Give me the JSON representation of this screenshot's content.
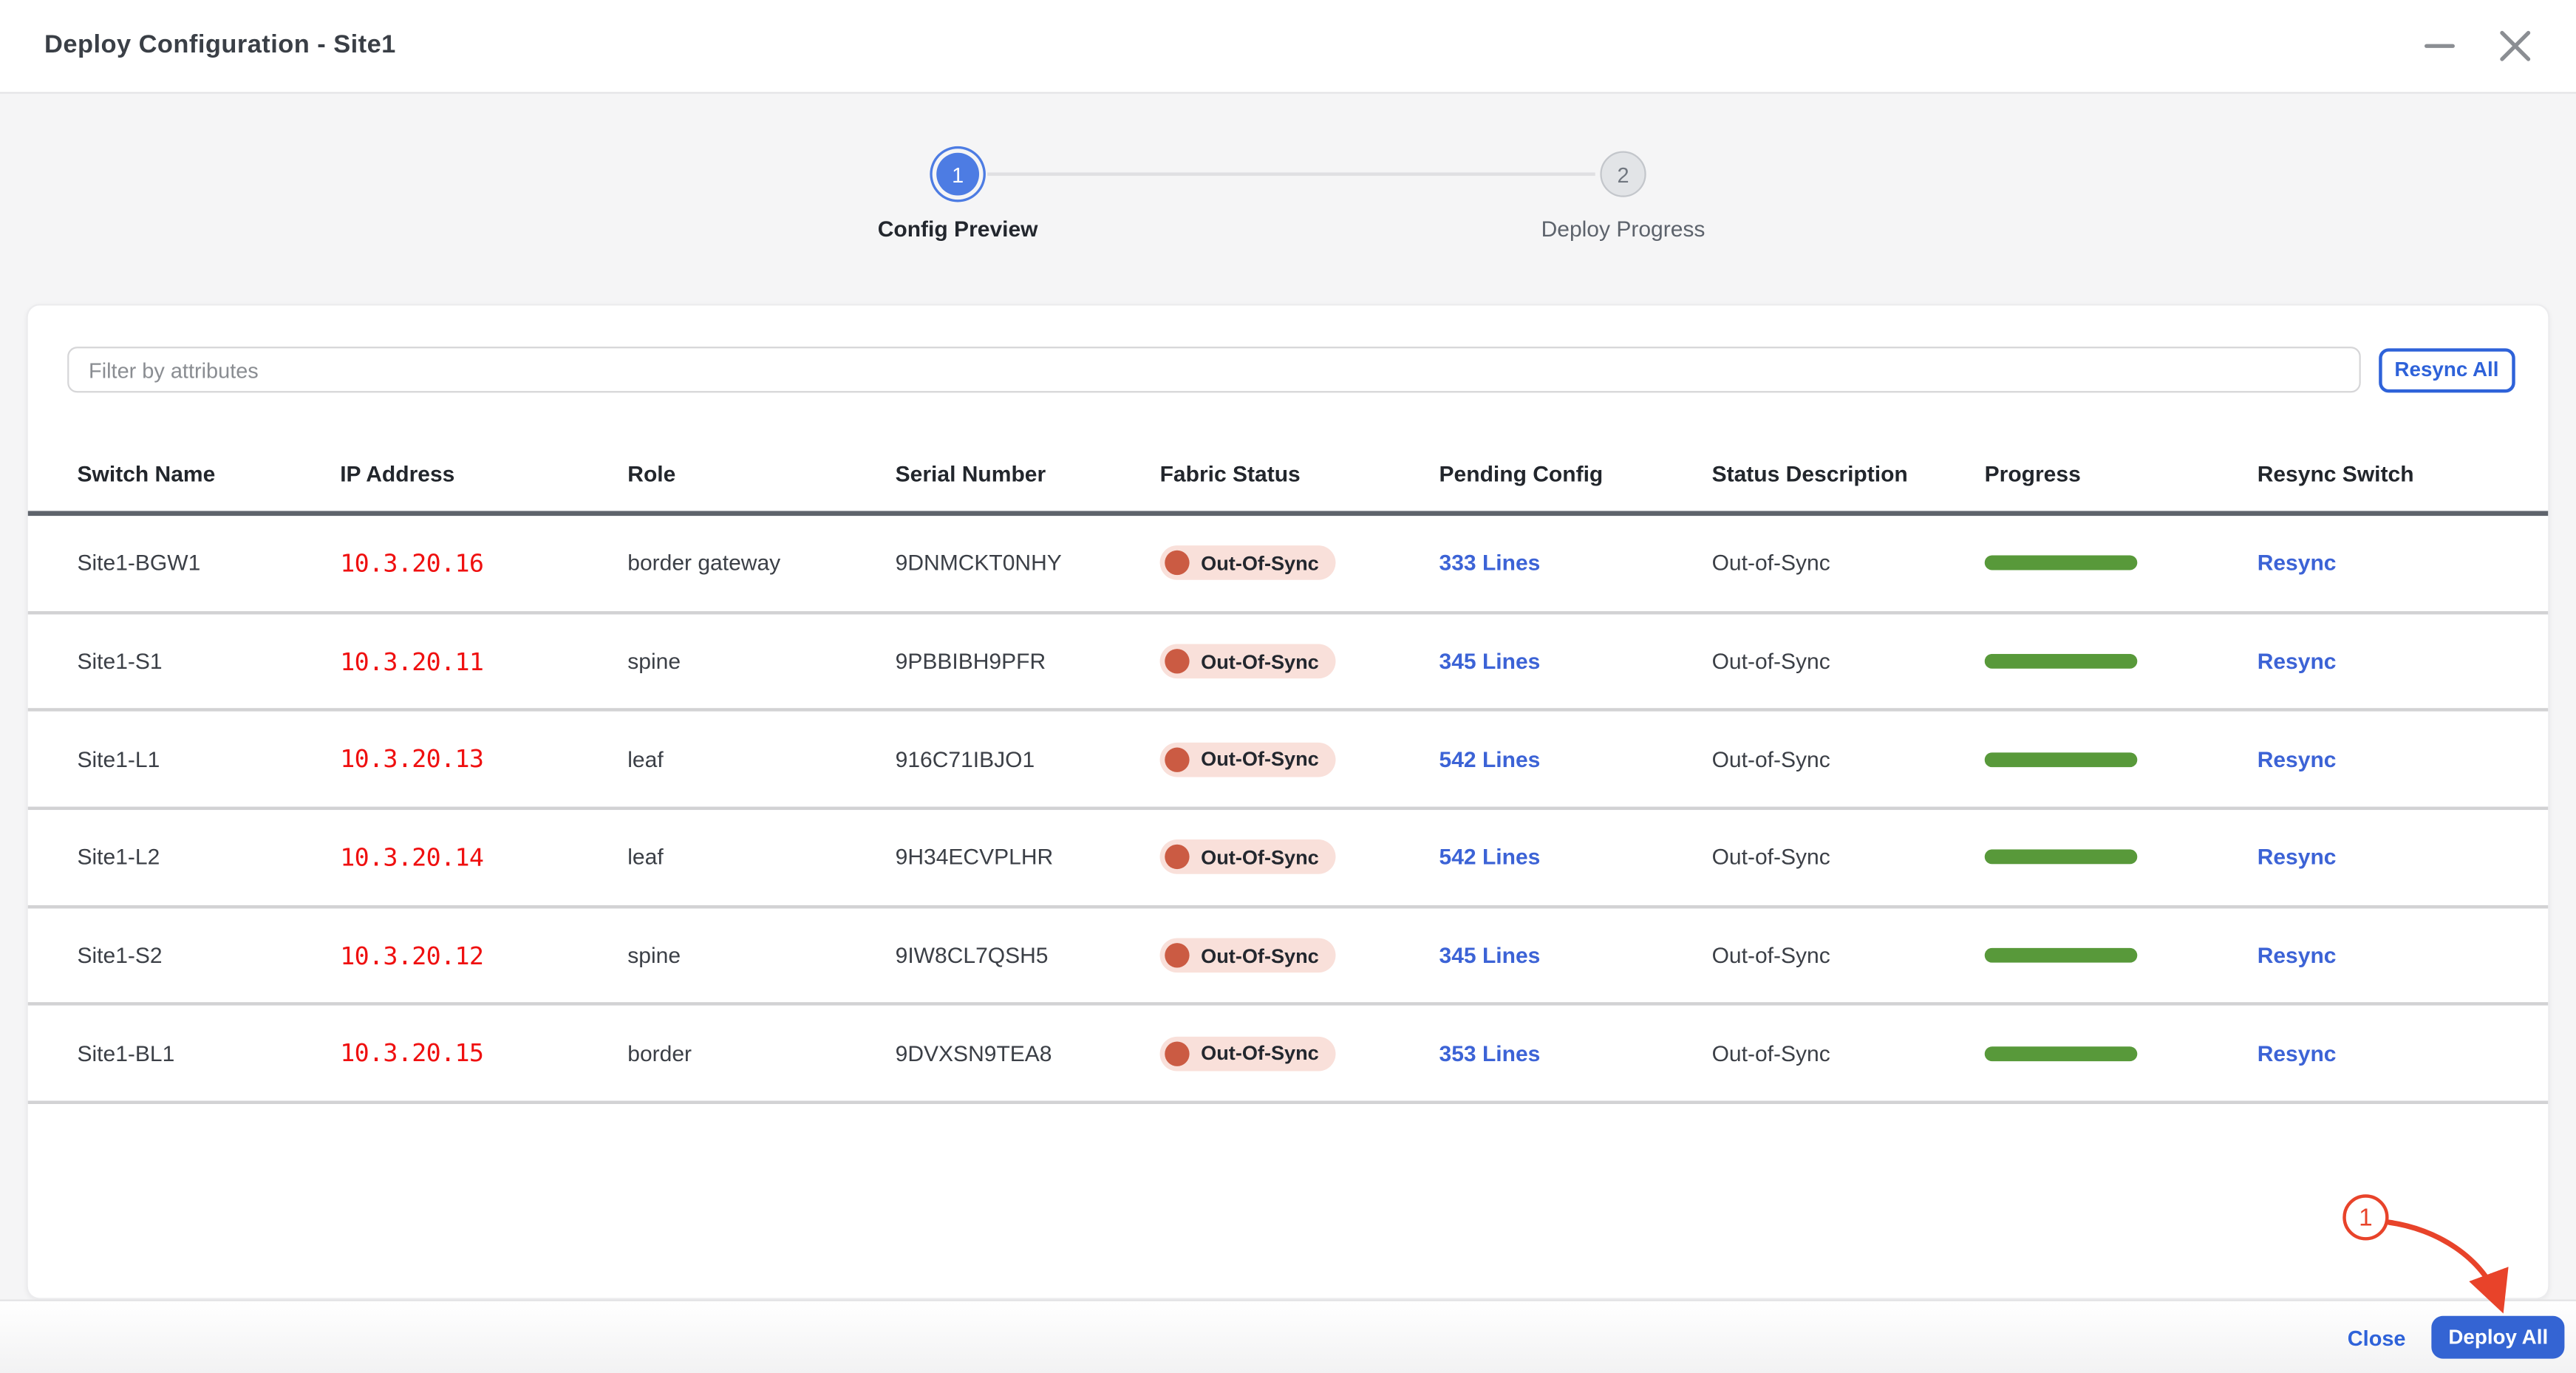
{
  "window": {
    "title": "Deploy Configuration - Site1"
  },
  "stepper": {
    "steps": [
      {
        "number": "1",
        "label": "Config Preview",
        "state": "active"
      },
      {
        "number": "2",
        "label": "Deploy Progress",
        "state": "inactive"
      }
    ]
  },
  "toolbar": {
    "filter_placeholder": "Filter by attributes",
    "resync_all_label": "Resync All"
  },
  "table": {
    "columns": [
      "Switch Name",
      "IP Address",
      "Role",
      "Serial Number",
      "Fabric Status",
      "Pending Config",
      "Status Description",
      "Progress",
      "Resync Switch"
    ],
    "rows": [
      {
        "switch_name": "Site1-BGW1",
        "ip": "10.3.20.16",
        "role": "border gateway",
        "serial": "9DNMCKT0NHY",
        "fabric_status": "Out-Of-Sync",
        "pending_config": "333 Lines",
        "status_description": "Out-of-Sync",
        "progress_percent": 100,
        "resync_label": "Resync"
      },
      {
        "switch_name": "Site1-S1",
        "ip": "10.3.20.11",
        "role": "spine",
        "serial": "9PBBIBH9PFR",
        "fabric_status": "Out-Of-Sync",
        "pending_config": "345 Lines",
        "status_description": "Out-of-Sync",
        "progress_percent": 100,
        "resync_label": "Resync"
      },
      {
        "switch_name": "Site1-L1",
        "ip": "10.3.20.13",
        "role": "leaf",
        "serial": "916C71IBJO1",
        "fabric_status": "Out-Of-Sync",
        "pending_config": "542 Lines",
        "status_description": "Out-of-Sync",
        "progress_percent": 100,
        "resync_label": "Resync"
      },
      {
        "switch_name": "Site1-L2",
        "ip": "10.3.20.14",
        "role": "leaf",
        "serial": "9H34ECVPLHR",
        "fabric_status": "Out-Of-Sync",
        "pending_config": "542 Lines",
        "status_description": "Out-of-Sync",
        "progress_percent": 100,
        "resync_label": "Resync"
      },
      {
        "switch_name": "Site1-S2",
        "ip": "10.3.20.12",
        "role": "spine",
        "serial": "9IW8CL7QSH5",
        "fabric_status": "Out-Of-Sync",
        "pending_config": "345 Lines",
        "status_description": "Out-of-Sync",
        "progress_percent": 100,
        "resync_label": "Resync"
      },
      {
        "switch_name": "Site1-BL1",
        "ip": "10.3.20.15",
        "role": "border",
        "serial": "9DVXSN9TEA8",
        "fabric_status": "Out-Of-Sync",
        "pending_config": "353 Lines",
        "status_description": "Out-of-Sync",
        "progress_percent": 100,
        "resync_label": "Resync"
      }
    ]
  },
  "annotation": {
    "step_number": "1"
  },
  "footer": {
    "close_label": "Close",
    "deploy_all_label": "Deploy All"
  },
  "icons": {
    "minimize": "minimize-icon",
    "close": "close-icon",
    "status_dot": "status-dot-icon",
    "annotation_arrow": "annotation-arrow-icon"
  },
  "colors": {
    "accent_blue": "#2e62d9",
    "link_blue": "#3c63d6",
    "primary_button_blue": "#3464d3",
    "stepper_active_blue": "#4d7ce3",
    "ip_red": "#ef1010",
    "badge_background": "#f9e0da",
    "badge_dot": "#cb5b43",
    "progress_green": "#58993a",
    "annotation_red": "#e8432a",
    "page_background": "#f5f5f6"
  }
}
